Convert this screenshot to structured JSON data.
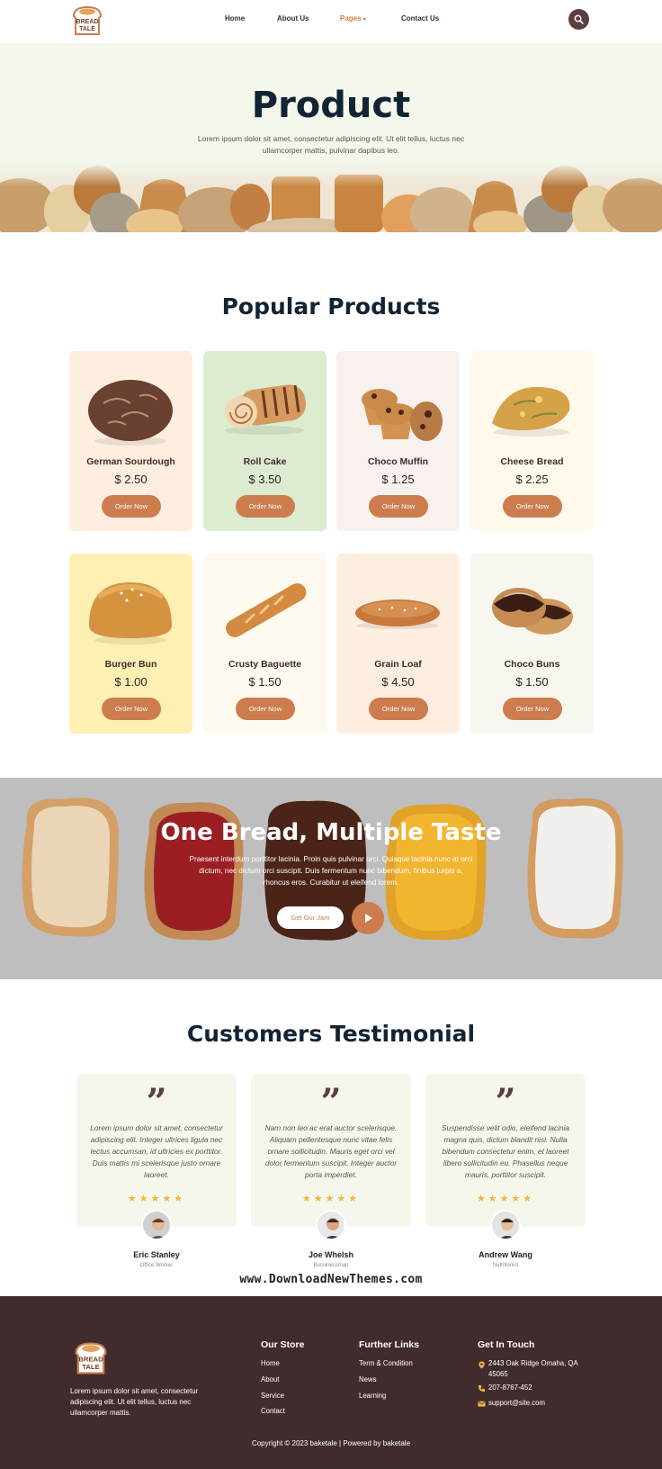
{
  "header": {
    "logo_line1": "BREAD",
    "logo_line2": "TALE",
    "nav": [
      "Home",
      "About Us",
      "Pages",
      "Contact Us"
    ]
  },
  "hero": {
    "title": "Product",
    "subtitle": "Lorem ipsum dolor sit amet, consectetur adipiscing elit. Ut elit tellus, luctus nec ullamcorper mattis, pulvinar dapibus leo."
  },
  "popular": {
    "title": "Popular Products",
    "button_label": "Order Now",
    "items": [
      {
        "name": "German Sourdough",
        "price": "$ 2.50",
        "bg": "#fdeee0"
      },
      {
        "name": "Roll Cake",
        "price": "$ 3.50",
        "bg": "#dcecd0"
      },
      {
        "name": "Choco Muffin",
        "price": "$ 1.25",
        "bg": "#f8f1ed"
      },
      {
        "name": "Cheese Bread",
        "price": "$ 2.25",
        "bg": "#fff9eb"
      },
      {
        "name": "Burger Bun",
        "price": "$ 1.00",
        "bg": "#feefb3"
      },
      {
        "name": "Crusty Baguette",
        "price": "$ 1.50",
        "bg": "#fffaf0"
      },
      {
        "name": "Grain Loaf",
        "price": "$ 4.50",
        "bg": "#fdeee0"
      },
      {
        "name": "Choco Buns",
        "price": "$ 1.50",
        "bg": "#f7f7ef"
      }
    ]
  },
  "banner": {
    "title": "One Bread, Multiple Taste",
    "text": "Praesent interdum porttitor lacinia. Proin quis pulvinar orci. Quisque lacinia nunc at orci dictum, nec dictum orci suscipit. Duis fermentum nunc bibendum, finibus turpis a, rhoncus eros. Curabitur ut eleifend lorem.",
    "button_label": "Get Our Jam"
  },
  "testimonials": {
    "title": "Customers Testimonial",
    "items": [
      {
        "text": "Lorem ipsum dolor sit amet, consectetur adipiscing elit. Integer ultrices ligula nec lectus accumsan, id ultricies ex porttitor. Duis mattis mi scelerisque justo ornare laoreet.",
        "name": "Eric Stanley",
        "role": "Office Worker"
      },
      {
        "text": "Nam non leo ac erat auctor scelerisque. Aliquam pellentesque nunc vitae felis ornare sollicitudin. Mauris eget orci vel dolor fermentum suscipit. Integer auctor porta imperdiet.",
        "name": "Joe Whelsh",
        "role": "Bussinessman"
      },
      {
        "text": "Suspendisse velit odio, eleifend lacinia magna quis, dictum blandit nisi. Nulla bibendum consectetur enim, et laoreet libero sollicitudin eu. Phasellus neque mauris, porttitor suscipit.",
        "name": "Andrew Wang",
        "role": "Nutritionist"
      }
    ]
  },
  "watermark": "www.DownloadNewThemes.com",
  "footer": {
    "description": "Lorem ipsum dolor sit amet, consectetur adipiscing elit. Ut elit tellus, luctus nec ullamcorper mattis.",
    "store": {
      "title": "Our Store",
      "links": [
        "Home",
        "About",
        "Service",
        "Contact"
      ]
    },
    "further": {
      "title": "Further Links",
      "links": [
        "Term & Condition",
        "News",
        "Learning"
      ]
    },
    "touch": {
      "title": "Get In Touch",
      "address": "2443 Oak Ridge Omaha, QA 45065",
      "phone": "207-8767-452",
      "email": "support@site.com"
    },
    "copyright": "Copyright © 2023 baketale | Powered by baketale"
  },
  "colors": {
    "accent": "#cd7d4d",
    "dark": "#402c2d",
    "heading": "#122433",
    "star": "#f2b73b"
  }
}
